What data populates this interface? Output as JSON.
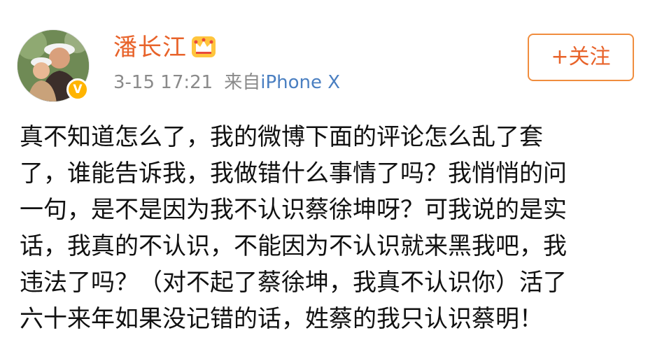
{
  "author": {
    "name": "潘长江",
    "verified_badge": "V",
    "member_badge_icon": "crown-icon",
    "avatar_icon": "avatar-photo"
  },
  "meta": {
    "timestamp": "3-15 17:21",
    "source_prefix": "来自",
    "source_device": "iPhone X"
  },
  "follow_button": {
    "label": "+关注"
  },
  "content": {
    "lines": [
      "真不知道怎么了，我的微博下面的评论怎么乱了套",
      "了，谁能告诉我，我做错什么事情了吗？我悄悄的问",
      "一句，是不是因为我不认识蔡徐坤呀？可我说的是实",
      "话，我真的不认识，不能因为不认识就来黑我吧，我",
      "违法了吗？（对不起了蔡徐坤，我真不认识你）活了",
      "六十来年如果没记错的话，姓蔡的我只认识蔡明！"
    ]
  },
  "colors": {
    "name_orange": "#e8632a",
    "follow_border": "#f08d3e",
    "link_blue": "#4a7fc1",
    "meta_gray": "#8a8a8a",
    "verify_gold": "#ffb400"
  }
}
